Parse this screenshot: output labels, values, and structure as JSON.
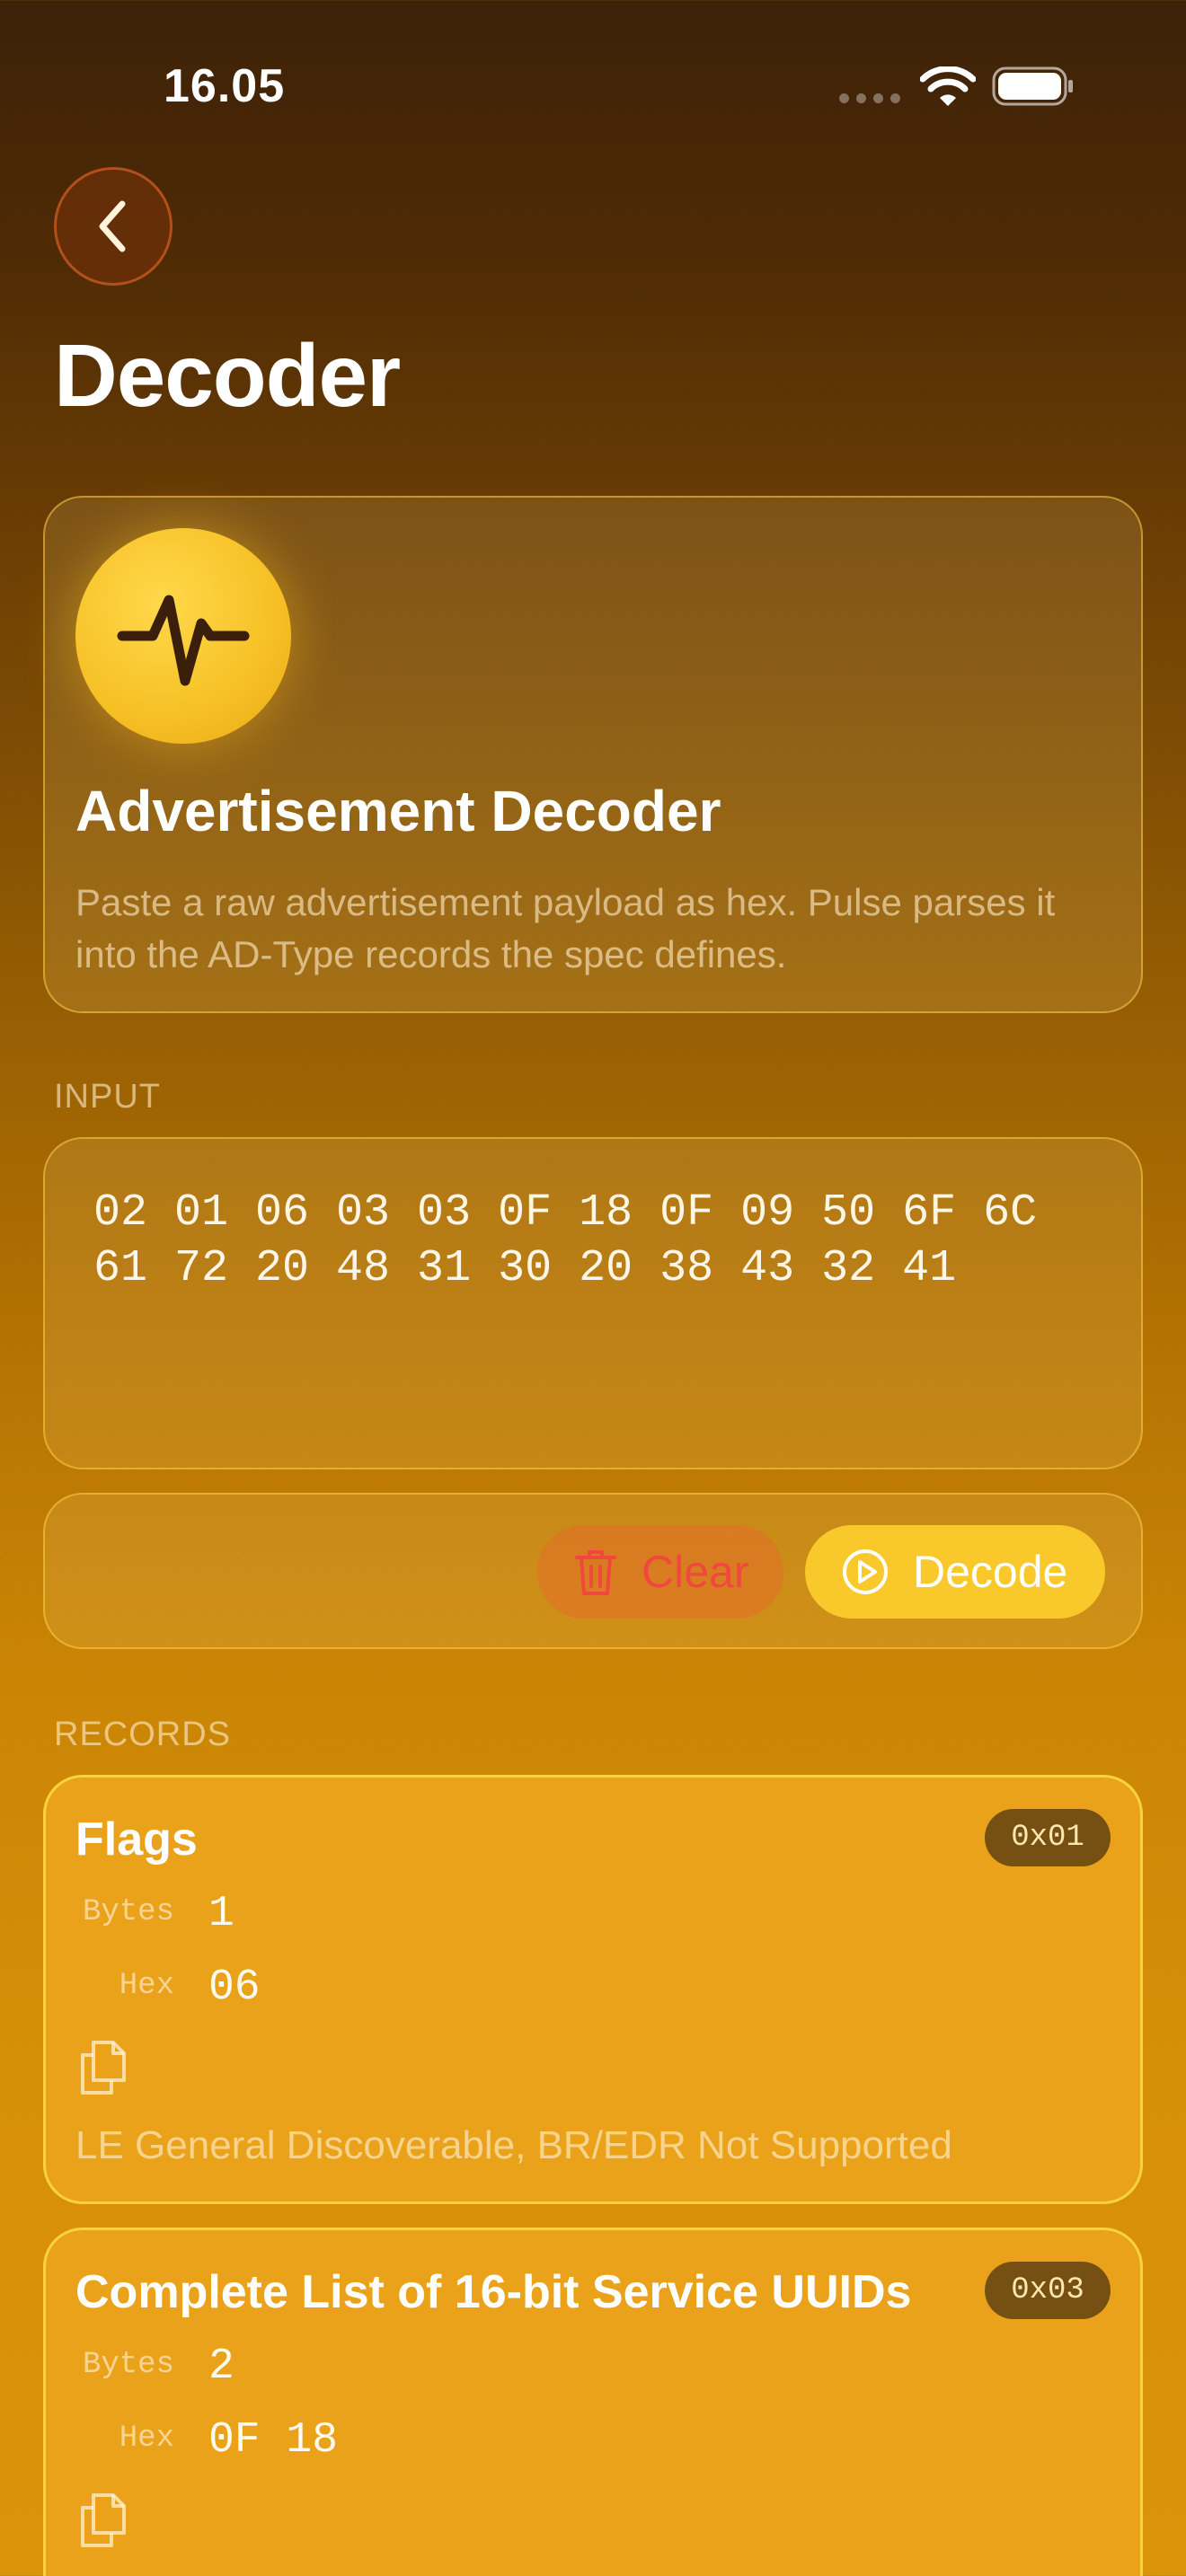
{
  "status_bar": {
    "time": "16.05"
  },
  "page": {
    "title": "Decoder"
  },
  "hero": {
    "title": "Advertisement Decoder",
    "description": "Paste a raw advertisement payload as hex. Pulse parses it into the AD-Type records the spec defines."
  },
  "input": {
    "section_label": "INPUT",
    "value": "02 01 06 03 03 0F 18 0F 09 50 6F 6C\n61 72 20 48 31 30 20 38 43 32 41"
  },
  "actions": {
    "clear_label": "Clear",
    "decode_label": "Decode"
  },
  "records": {
    "section_label": "RECORDS",
    "field_labels": {
      "bytes": "Bytes",
      "hex": "Hex"
    },
    "items": [
      {
        "title": "Flags",
        "type_code": "0x01",
        "bytes": "1",
        "hex": "06",
        "summary": "LE General Discoverable, BR/EDR Not Supported"
      },
      {
        "title": "Complete List of 16-bit Service UUIDs",
        "type_code": "0x03",
        "bytes": "2",
        "hex": "0F 18"
      }
    ]
  },
  "colors": {
    "accent_yellow": "#f9c92c",
    "destructive_red": "#f0483e",
    "badge_brown": "#765013"
  }
}
